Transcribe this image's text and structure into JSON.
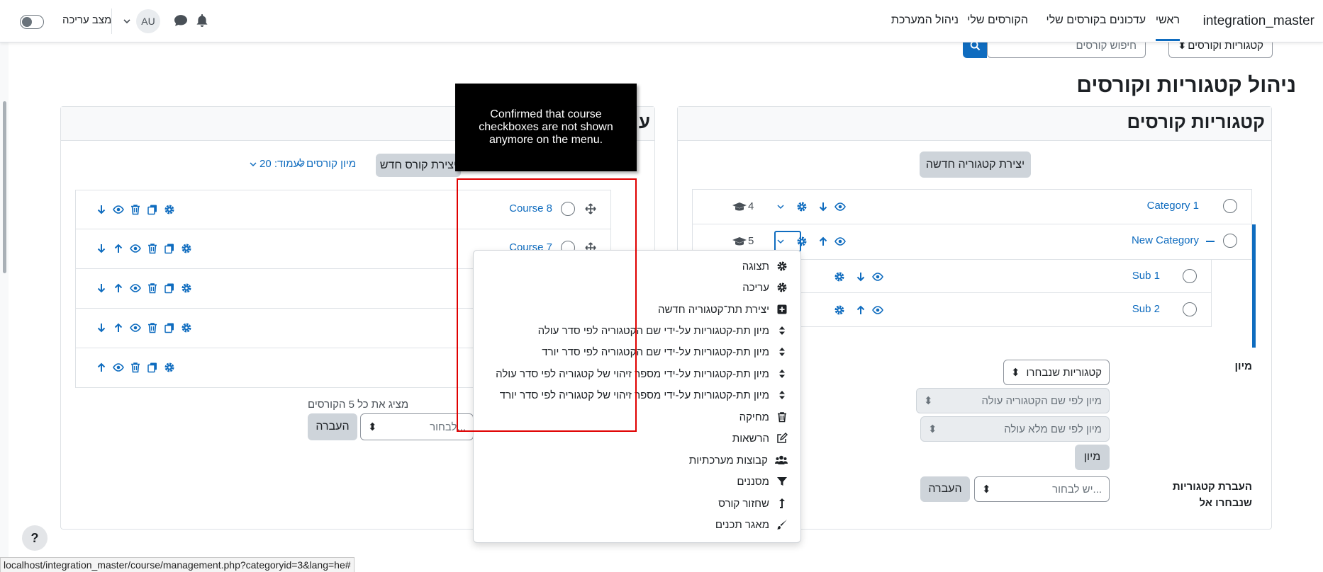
{
  "navbar": {
    "site_name": "integration_master",
    "links": [
      "ראשי",
      "עדכונים בקורסים שלי",
      "הקורסים שלי",
      "ניהול המערכת"
    ],
    "edit_mode_label": "מצב עריכה",
    "avatar_initials": "AU"
  },
  "top_controls": {
    "category_select": "קטגוריות וקורסים",
    "search_placeholder": "חיפוש קורסים"
  },
  "page_title": "ניהול קטגוריות וקורסים",
  "categories_panel": {
    "title": "קטגוריות קורסים",
    "create_button": "יצירת קטגוריה חדשה",
    "categories": [
      {
        "name": "Category 1",
        "count": "4"
      },
      {
        "name": "New Category",
        "count": "5"
      },
      {
        "name": "Sub 1"
      },
      {
        "name": "Sub 2"
      }
    ],
    "sort_label": "מיון",
    "sort_selected_select": "קטגוריות שנבחרו",
    "sort_option_1": "מיון לפי שם הקטגוריה עולה",
    "sort_option_2": "מיון לפי שם מלא עולה",
    "sort_button": "מיון",
    "move_label": "העברת קטגוריות שנבחרו אל",
    "move_select_placeholder": "יש לבחור...",
    "move_button": "העברה"
  },
  "courses_panel": {
    "title_fragment": "ע",
    "create_course_button": "יצירת קורס חדש",
    "sort_courses": "מיון קורסים",
    "per_page": "לעמוד: 20",
    "courses": [
      {
        "name": "Course 8"
      },
      {
        "name": "Course 7"
      },
      {
        "name": ""
      },
      {
        "name": ""
      },
      {
        "name": ""
      }
    ],
    "showing_all": "מציג את כל 5 הקורסים",
    "move_select_placeholder": "לבחור...",
    "move_button": "העברה"
  },
  "dropdown_menu": {
    "items": [
      {
        "label": "תצוגה",
        "icon": "gear-icon"
      },
      {
        "label": "עריכה",
        "icon": "gear-icon"
      },
      {
        "label": "יצירת תת־קטגוריה חדשה",
        "icon": "plus-square-icon"
      },
      {
        "label": "מיון תת-קטגוריות על-ידי שם הקטגוריה לפי סדר עולה",
        "icon": "sort-icon"
      },
      {
        "label": "מיון תת-קטגוריות על-ידי שם הקטגוריה לפי סדר יורד",
        "icon": "sort-icon"
      },
      {
        "label": "מיון תת-קטגוריות על-ידי מספר זיהוי של קטגוריה לפי סדר עולה",
        "icon": "sort-icon"
      },
      {
        "label": "מיון תת-קטגוריות על-ידי מספר זיהוי של קטגוריה לפי סדר יורד",
        "icon": "sort-icon"
      },
      {
        "label": "מחיקה",
        "icon": "trash-icon"
      },
      {
        "label": "הרשאות",
        "icon": "edit-icon"
      },
      {
        "label": "קבוצות מערכתיות",
        "icon": "users-icon"
      },
      {
        "label": "מסננים",
        "icon": "filter-icon"
      },
      {
        "label": "שחזור קורס",
        "icon": "level-up-icon"
      },
      {
        "label": "מאגר תכנים",
        "icon": "brush-icon"
      }
    ]
  },
  "tooltip": "Confirmed that course checkboxes are not shown anymore on the menu.",
  "status_url": "localhost/integration_master/course/management.php?categoryid=3&lang=he#",
  "help_label": "?",
  "colors": {
    "link": "#0f6cbf",
    "highlight": "#e00000"
  }
}
